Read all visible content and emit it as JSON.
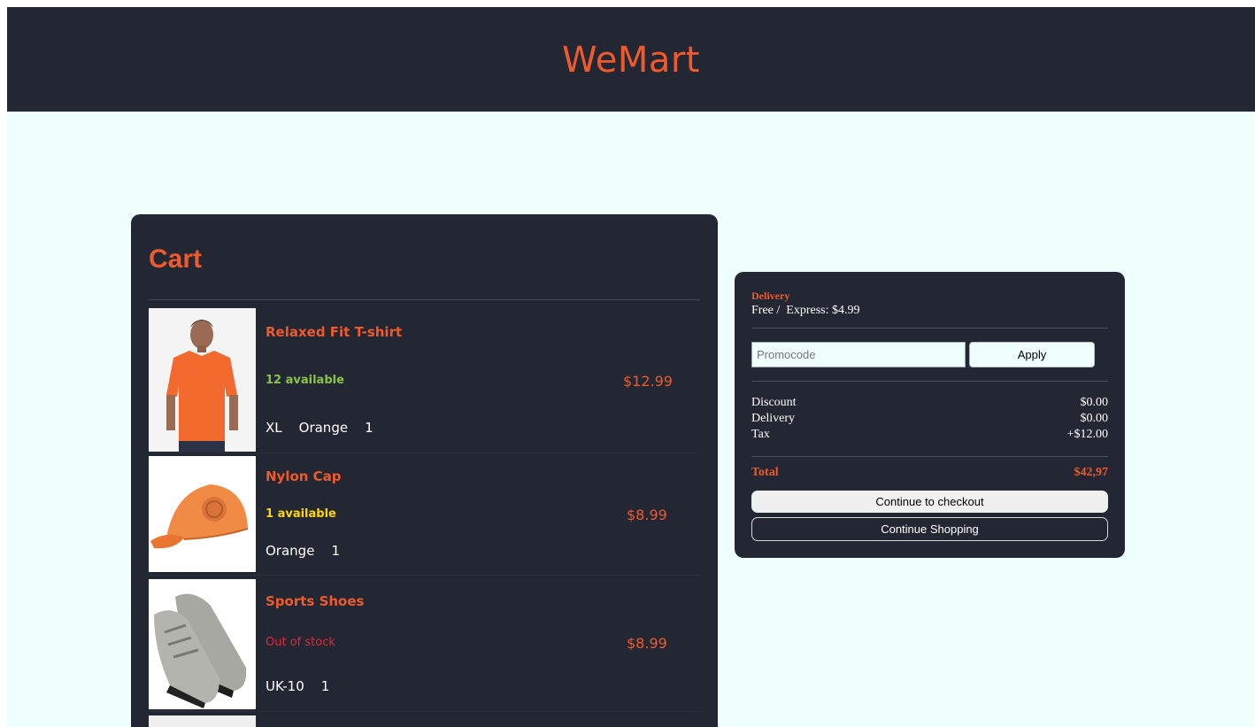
{
  "header": {
    "brand": "WeMart"
  },
  "cart": {
    "title": "Cart",
    "items": [
      {
        "name": "Relaxed Fit T-shirt",
        "stock": "12 available",
        "stock_color": "#8bc34a",
        "attrs": [
          "XL",
          "Orange",
          "1"
        ],
        "price": "$12.99",
        "image_icon": "orange-tshirt-photo"
      },
      {
        "name": "Nylon Cap",
        "stock": "1 available",
        "stock_color": "#ffd600",
        "attrs": [
          "Orange",
          "1"
        ],
        "price": "$8.99",
        "image_icon": "orange-cap-photo"
      },
      {
        "name": "Sports Shoes",
        "stock": "Out of stock",
        "stock_color": "#e0283c",
        "attrs": [
          "UK-10",
          "1"
        ],
        "price": "$8.99",
        "image_icon": "grey-shoes-photo"
      }
    ]
  },
  "summary": {
    "delivery_label": "Delivery",
    "delivery_options": "Free /  Express: $4.99",
    "promo_placeholder": "Promocode",
    "apply_label": "Apply",
    "rows": [
      {
        "label": "Discount",
        "value": "$0.00"
      },
      {
        "label": "Delivery",
        "value": "$0.00"
      },
      {
        "label": "Tax",
        "value": "+$12.00"
      }
    ],
    "total_label": "Total",
    "total_value": "$42,97",
    "checkout_label": "Continue to checkout",
    "continue_label": "Continue Shopping"
  },
  "colors": {
    "accent": "#ef5a2c",
    "panel": "#232733",
    "background": "#effffe"
  }
}
